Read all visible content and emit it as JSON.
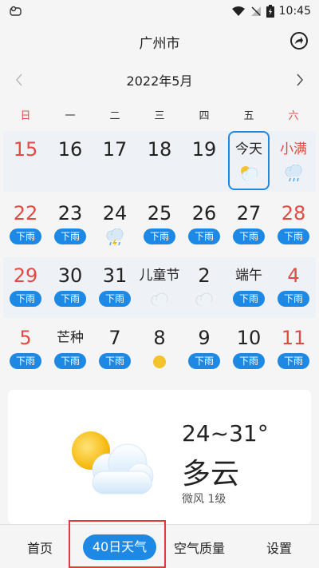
{
  "status_bar": {
    "time": "10:45"
  },
  "header": {
    "city": "广州市"
  },
  "month": {
    "title": "2022年5月"
  },
  "weekdays": [
    "日",
    "一",
    "二",
    "三",
    "四",
    "五",
    "六"
  ],
  "weeks": [
    [
      {
        "day": "15",
        "red": true,
        "badge": "",
        "icon": ""
      },
      {
        "day": "16",
        "red": false,
        "badge": "",
        "icon": ""
      },
      {
        "day": "17",
        "red": false,
        "badge": "",
        "icon": ""
      },
      {
        "day": "18",
        "red": false,
        "badge": "",
        "icon": ""
      },
      {
        "day": "19",
        "red": false,
        "badge": "",
        "icon": ""
      },
      {
        "day": "今天",
        "red": false,
        "badge": "",
        "icon": "cloudy-icon",
        "today": true
      },
      {
        "day": "小满",
        "red": true,
        "badge": "",
        "icon": "rain-cloud-icon"
      }
    ],
    [
      {
        "day": "22",
        "red": true,
        "badge": "下雨",
        "icon": ""
      },
      {
        "day": "23",
        "red": false,
        "badge": "下雨",
        "icon": ""
      },
      {
        "day": "24",
        "red": false,
        "badge": "",
        "icon": "thunder-rain-icon"
      },
      {
        "day": "25",
        "red": false,
        "badge": "下雨",
        "icon": ""
      },
      {
        "day": "26",
        "red": false,
        "badge": "下雨",
        "icon": ""
      },
      {
        "day": "27",
        "red": false,
        "badge": "下雨",
        "icon": ""
      },
      {
        "day": "28",
        "red": true,
        "badge": "下雨",
        "icon": ""
      }
    ],
    [
      {
        "day": "29",
        "red": true,
        "badge": "下雨",
        "icon": ""
      },
      {
        "day": "30",
        "red": false,
        "badge": "下雨",
        "icon": ""
      },
      {
        "day": "31",
        "red": false,
        "badge": "下雨",
        "icon": ""
      },
      {
        "day": "儿童节",
        "red": false,
        "badge": "",
        "icon": "overcast-icon"
      },
      {
        "day": "2",
        "red": false,
        "badge": "",
        "icon": "overcast-icon"
      },
      {
        "day": "端午",
        "red": false,
        "badge": "下雨",
        "icon": ""
      },
      {
        "day": "4",
        "red": true,
        "badge": "下雨",
        "icon": ""
      }
    ],
    [
      {
        "day": "5",
        "red": true,
        "badge": "下雨",
        "icon": ""
      },
      {
        "day": "芒种",
        "red": false,
        "badge": "下雨",
        "icon": ""
      },
      {
        "day": "7",
        "red": false,
        "badge": "下雨",
        "icon": ""
      },
      {
        "day": "8",
        "red": false,
        "badge": "",
        "icon": "sun-icon"
      },
      {
        "day": "9",
        "red": false,
        "badge": "下雨",
        "icon": ""
      },
      {
        "day": "10",
        "red": false,
        "badge": "下雨",
        "icon": ""
      },
      {
        "day": "11",
        "red": true,
        "badge": "下雨",
        "icon": ""
      }
    ]
  ],
  "weather_card": {
    "temp": "24~31°",
    "condition": "多云",
    "wind": "微风 1级",
    "icon": "partly-cloudy-icon"
  },
  "nav": {
    "tabs": [
      {
        "label": "首页",
        "active": false
      },
      {
        "label": "40日天气",
        "active": true
      },
      {
        "label": "空气质量",
        "active": false
      },
      {
        "label": "设置",
        "active": false
      }
    ]
  },
  "colors": {
    "accent": "#1e88e5",
    "red": "#e24a43",
    "highlight": "#e53935"
  }
}
